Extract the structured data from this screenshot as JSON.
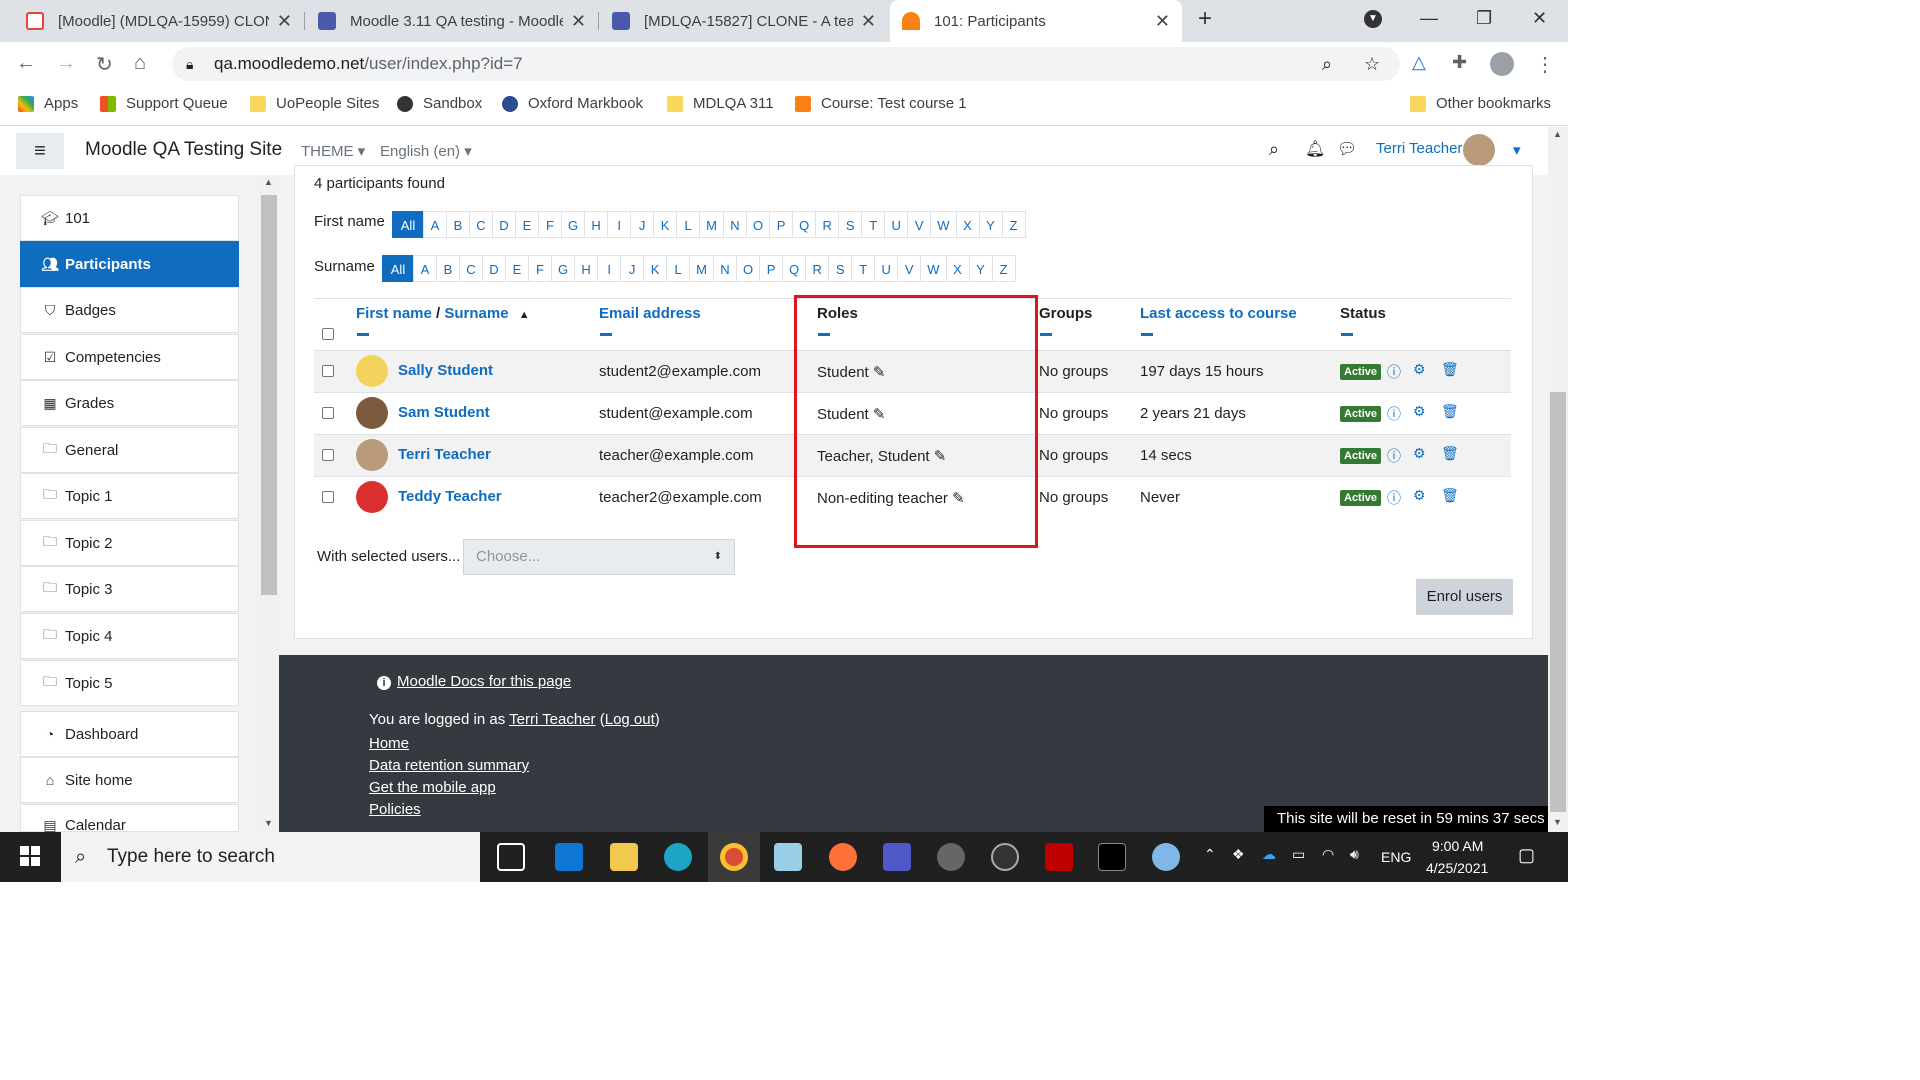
{
  "browser": {
    "tabs": [
      {
        "title": "[Moodle] (MDLQA-15959) CLONE",
        "icon": "gmail-icon"
      },
      {
        "title": "Moodle 3.11 QA testing - Moodle",
        "icon": "moodle-tracker-icon"
      },
      {
        "title": "[MDLQA-15827] CLONE - A teach",
        "icon": "moodle-tracker-icon"
      },
      {
        "title": "101: Participants",
        "icon": "moodle-icon"
      }
    ],
    "url_host": "qa.moodledemo.net",
    "url_path": "/user/index.php?id=7",
    "bookmarks": [
      "Apps",
      "Support Queue",
      "UoPeople Sites",
      "Sandbox",
      "Oxford Markbook",
      "MDLQA 311",
      "Course: Test course 1"
    ],
    "other_bookmarks": "Other bookmarks"
  },
  "navbar": {
    "site_name": "Moodle QA Testing Site",
    "theme": "THEME",
    "language": "English (en)",
    "user": "Terri Teacher"
  },
  "sidebar": {
    "items": [
      "101",
      "Participants",
      "Badges",
      "Competencies",
      "Grades",
      "General",
      "Topic 1",
      "Topic 2",
      "Topic 3",
      "Topic 4",
      "Topic 5"
    ],
    "bottom_items": [
      "Dashboard",
      "Site home",
      "Calendar"
    ]
  },
  "main": {
    "found": "4 participants found",
    "firstname_label": "First name",
    "surname_label": "Surname",
    "letters": [
      "All",
      "A",
      "B",
      "C",
      "D",
      "E",
      "F",
      "G",
      "H",
      "I",
      "J",
      "K",
      "L",
      "M",
      "N",
      "O",
      "P",
      "Q",
      "R",
      "S",
      "T",
      "U",
      "V",
      "W",
      "X",
      "Y",
      "Z"
    ],
    "headers": {
      "firstname": "First name",
      "slash": " / ",
      "surname": "Surname",
      "email": "Email address",
      "roles": "Roles",
      "groups": "Groups",
      "last_access": "Last access to course",
      "status": "Status"
    },
    "rows": [
      {
        "name": "Sally Student",
        "email": "student2@example.com",
        "roles": "Student",
        "groups": "No groups",
        "last_access": "197 days 15 hours",
        "status": "Active"
      },
      {
        "name": "Sam Student",
        "email": "student@example.com",
        "roles": "Student",
        "groups": "No groups",
        "last_access": "2 years 21 days",
        "status": "Active"
      },
      {
        "name": "Terri Teacher",
        "email": "teacher@example.com",
        "roles": "Teacher, Student",
        "groups": "No groups",
        "last_access": "14 secs",
        "status": "Active"
      },
      {
        "name": "Teddy Teacher",
        "email": "teacher2@example.com",
        "roles": "Non-editing teacher",
        "groups": "No groups",
        "last_access": "Never",
        "status": "Active"
      }
    ],
    "with_selected": "With selected users...",
    "choose": "Choose...",
    "enrol": "Enrol users"
  },
  "footer": {
    "docs": "Moodle Docs for this page",
    "logged_in_prefix": "You are logged in as ",
    "logged_in_user": "Terri Teacher",
    "logout": "Log out",
    "links": [
      "Home",
      "Data retention summary",
      "Get the mobile app",
      "Policies"
    ],
    "reset": "This site will be reset in 59 mins 37 secs"
  },
  "taskbar": {
    "search": "Type here to search",
    "lang": "ENG",
    "time": "9:00 AM",
    "date": "4/25/2021"
  }
}
